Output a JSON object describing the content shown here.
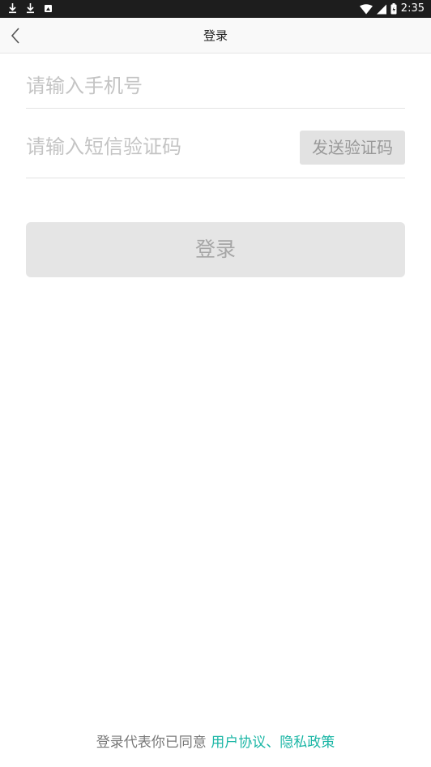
{
  "status_bar": {
    "time": "2:35",
    "icons": [
      "download-icon",
      "download-icon",
      "notification-icon",
      "wifi-icon",
      "signal-icon",
      "battery-icon"
    ]
  },
  "header": {
    "title": "登录",
    "back_icon": "chevron-left-icon"
  },
  "form": {
    "phone_placeholder": "请输入手机号",
    "phone_value": "",
    "code_placeholder": "请输入短信验证码",
    "code_value": "",
    "send_code_label": "发送验证码"
  },
  "login_button": {
    "label": "登录"
  },
  "agreement": {
    "prefix": "登录代表你已同意 ",
    "user_agreement": "用户协议",
    "separator": "、",
    "privacy_policy": "隐私政策"
  },
  "colors": {
    "status_bar": "#1d1d1d",
    "app_bar": "#f9f9f9",
    "button_disabled": "#e5e5e5",
    "link": "#1bb6a5",
    "placeholder": "#c4c4c4"
  }
}
